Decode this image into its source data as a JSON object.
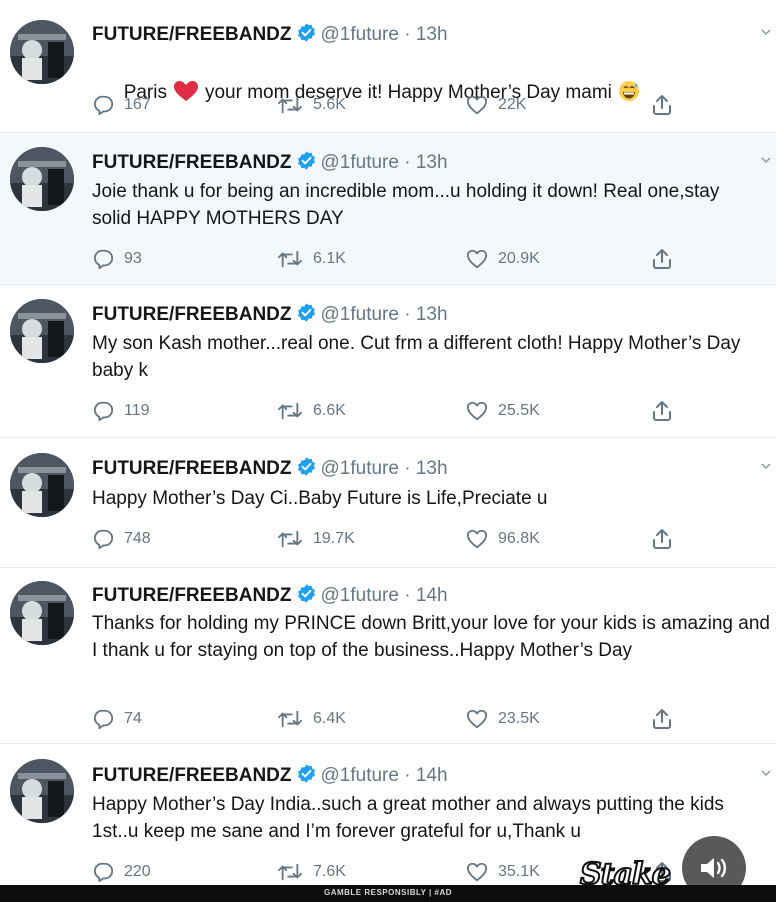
{
  "account": {
    "name": "FUTURE/FREEBANDZ",
    "handle": "@1future",
    "separator": "·"
  },
  "colors": {
    "verified": "#1da1f2",
    "meta": "#657786",
    "text": "#14171a",
    "heart": "#e0245e"
  },
  "tweets": [
    {
      "time": "13h",
      "text_before": "Paris",
      "text_after": "your mom deserve it! Happy Mother’s Day mami",
      "replies": "167",
      "retweets": "5.6K",
      "likes": "22K"
    },
    {
      "time": "13h",
      "text": "Joie thank u for being an incredible mom...u holding it down! Real one,stay solid HAPPY MOTHERS DAY",
      "replies": "93",
      "retweets": "6.1K",
      "likes": "20.9K"
    },
    {
      "time": "13h",
      "text": "My son Kash mother...real one. Cut frm a different cloth! Happy Mother’s Day baby k",
      "replies": "119",
      "retweets": "6.6K",
      "likes": "25.5K"
    },
    {
      "time": "13h",
      "text": "Happy Mother’s Day Ci..Baby Future is Life,Preciate u",
      "replies": "748",
      "retweets": "19.7K",
      "likes": "96.8K"
    },
    {
      "time": "14h",
      "text": "Thanks for holding my PRINCE down Britt,your love for your kids is amazing and I thank u for staying on top of the business..Happy Mother’s Day",
      "replies": "74",
      "retweets": "6.4K",
      "likes": "23.5K"
    },
    {
      "time": "14h",
      "text": "Happy Mother’s Day India..such a great mother and always putting the kids 1st..u keep me sane and I’m forever grateful for u,Thank u",
      "replies": "220",
      "retweets": "7.6K",
      "likes": "35.1K"
    }
  ],
  "overlay": {
    "brand": "Stake",
    "disclaimer": "GAMBLE RESPONSIBLY | #AD"
  },
  "icons": [
    "avatar",
    "verified-badge-icon",
    "heart-emoji-icon",
    "grin-sweat-emoji-icon",
    "reply-icon",
    "retweet-icon",
    "like-icon",
    "share-icon",
    "caret-down-icon",
    "speaker-icon"
  ]
}
